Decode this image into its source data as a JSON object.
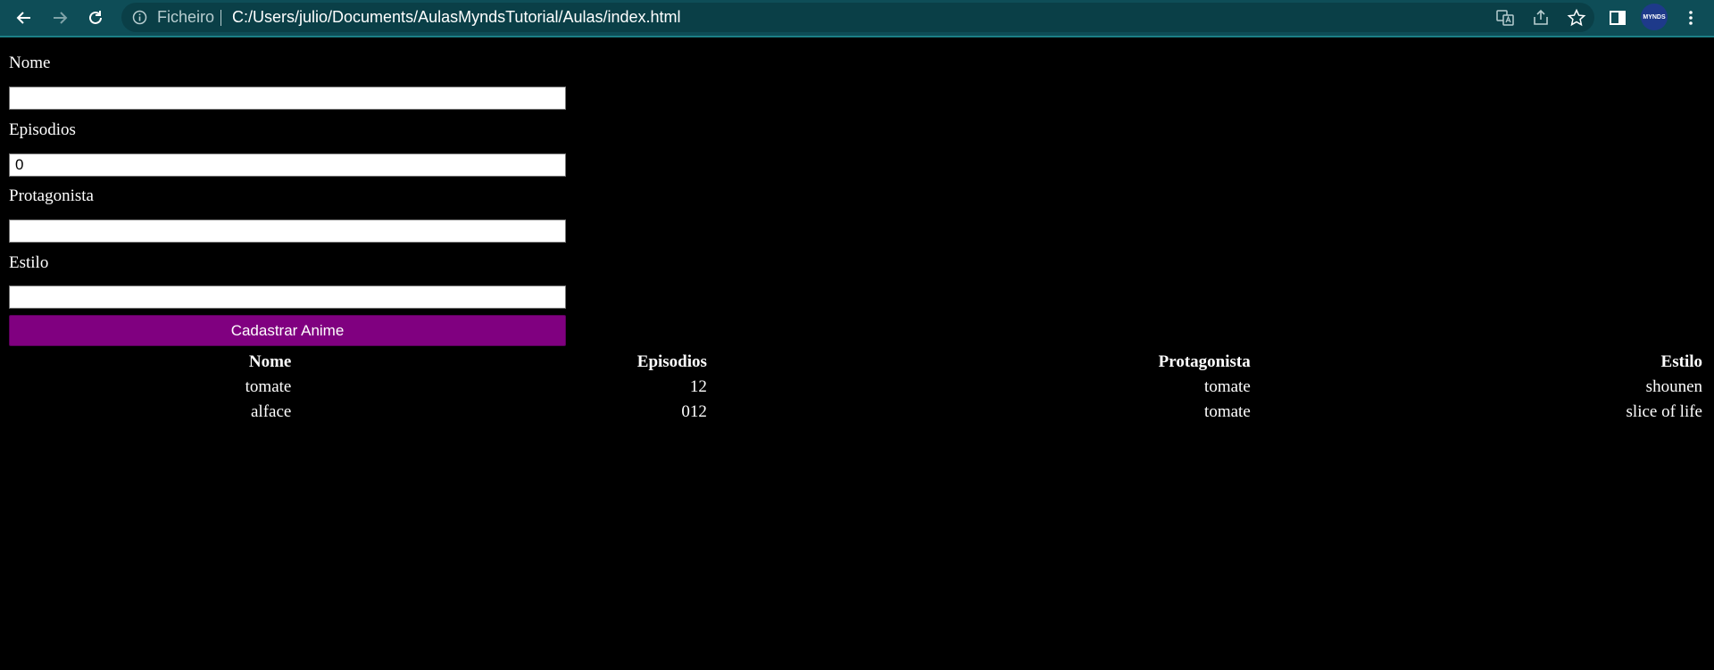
{
  "browser": {
    "scheme_label": "Ficheiro",
    "url": "C:/Users/julio/Documents/AulasMyndsTutorial/Aulas/index.html",
    "profile_label": "MYNDS",
    "toolbar_color": "#0e4d57"
  },
  "form": {
    "nome": {
      "label": "Nome",
      "value": ""
    },
    "episodios": {
      "label": "Episodios",
      "value": "0"
    },
    "protagonista": {
      "label": "Protagonista",
      "value": ""
    },
    "estilo": {
      "label": "Estilo",
      "value": ""
    },
    "submit_label": "Cadastrar Anime",
    "submit_color": "#800080"
  },
  "table": {
    "headers": [
      "Nome",
      "Episodios",
      "Protagonista",
      "Estilo"
    ],
    "rows": [
      [
        "tomate",
        "12",
        "tomate",
        "shounen"
      ],
      [
        "alface",
        "012",
        "tomate",
        "slice of life"
      ]
    ]
  }
}
